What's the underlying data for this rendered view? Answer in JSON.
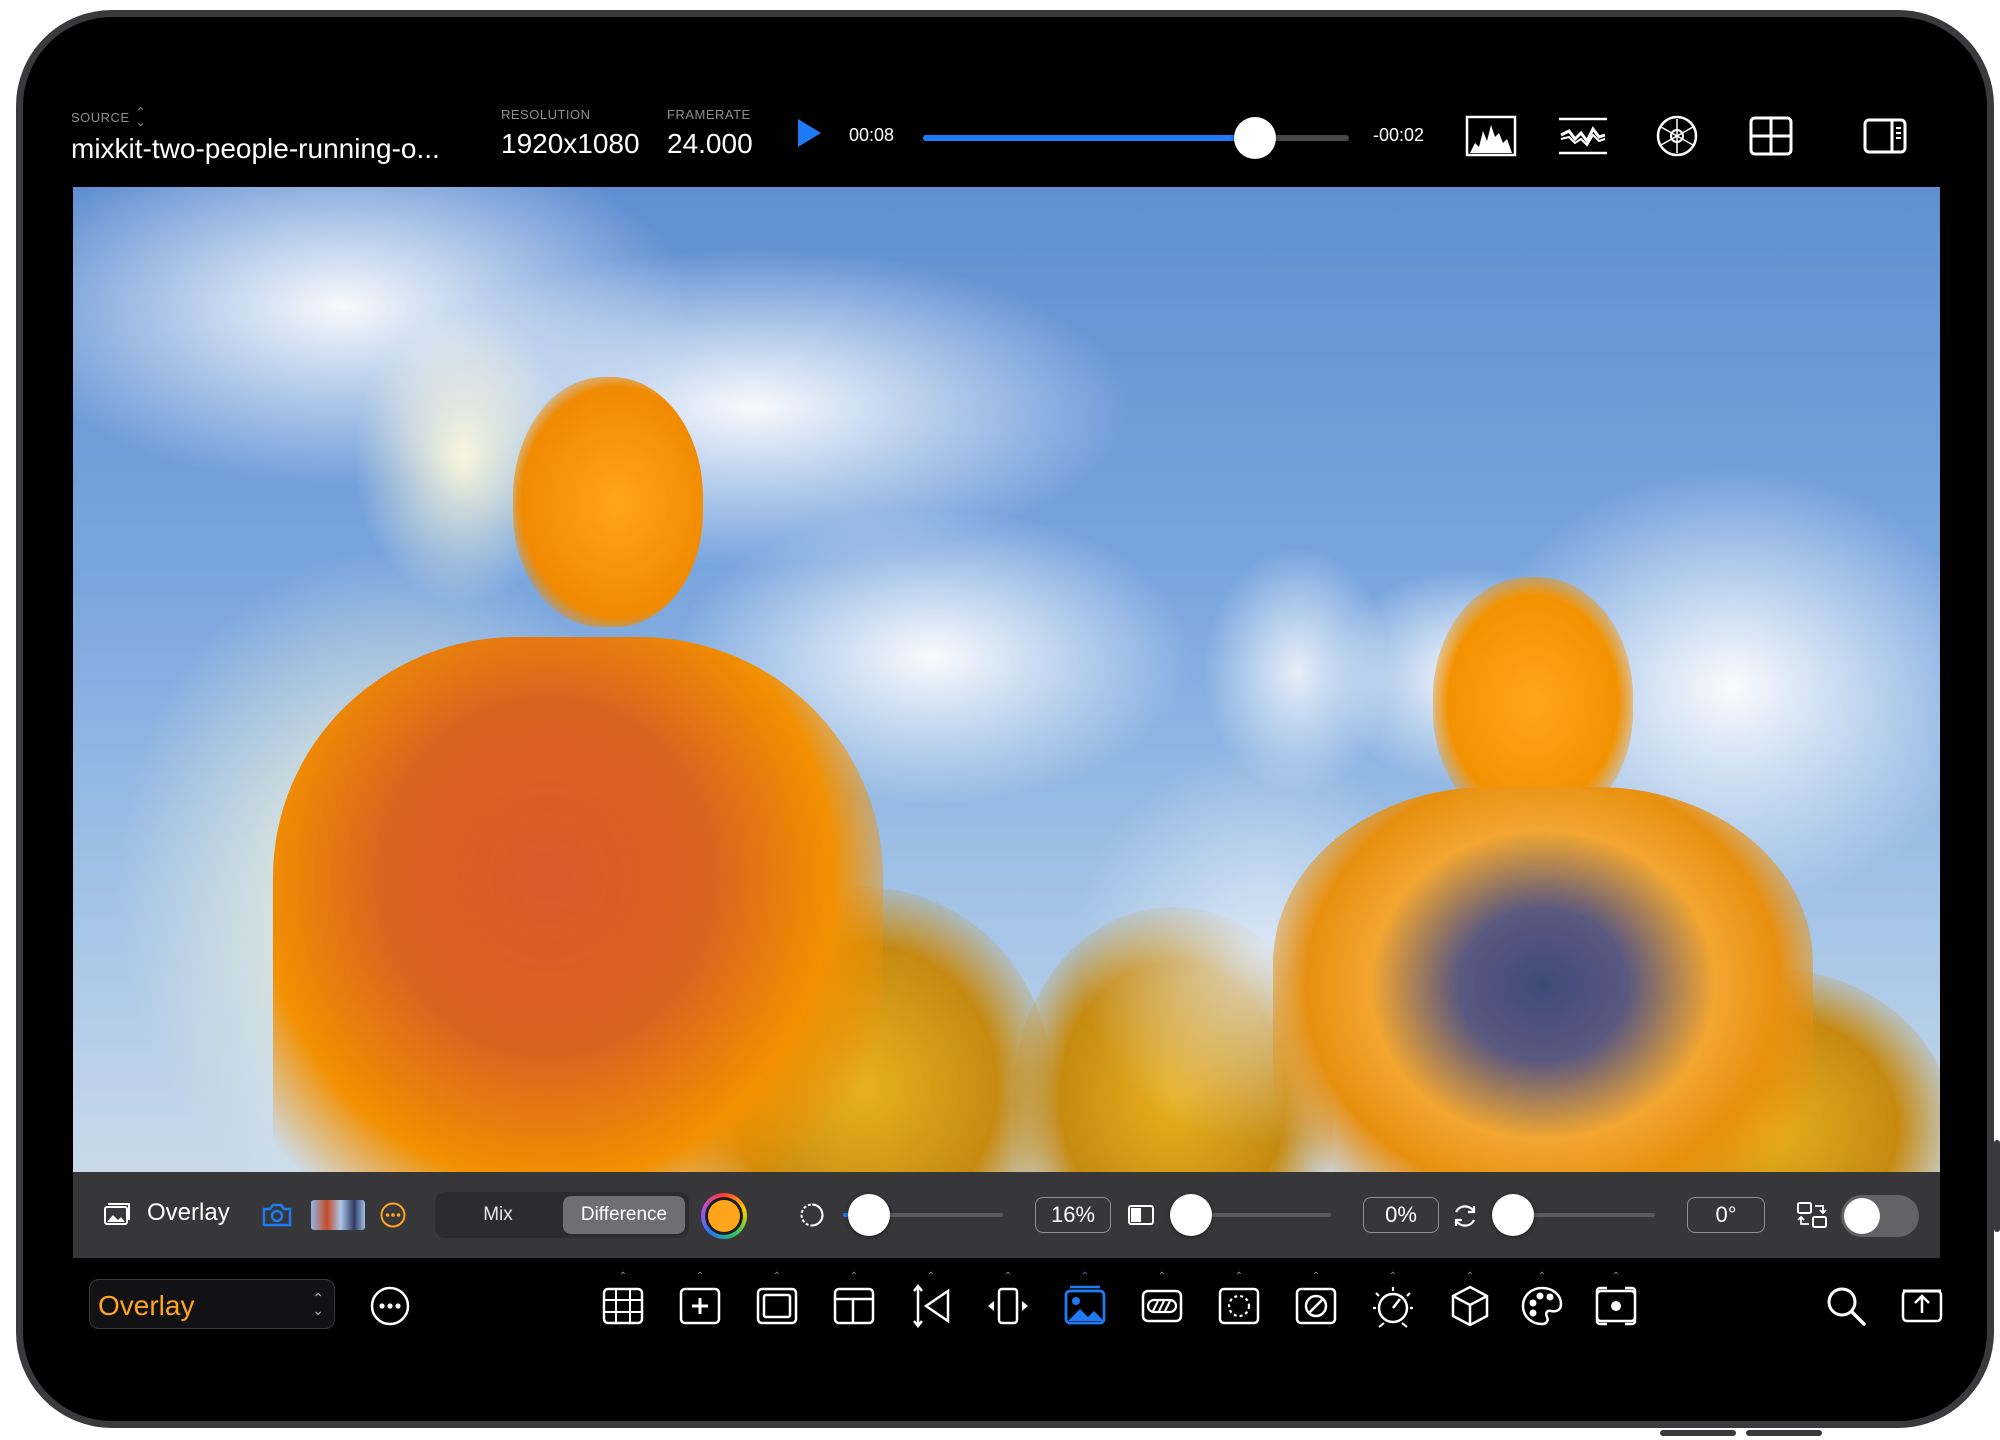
{
  "app": {
    "source_label": "SOURCE",
    "source_value": "mixkit-two-people-running-o...",
    "resolution_label": "RESOLUTION",
    "resolution_value": "1920x1080",
    "framerate_label": "FRAMERATE",
    "framerate_value": "24.000"
  },
  "playback": {
    "elapsed": "00:08",
    "remaining": "-00:02",
    "progress": 0.78
  },
  "top_icons": [
    "histogram-icon",
    "waveform-icon",
    "vectorscope-icon",
    "grid-layout-icon",
    "sidebar-icon"
  ],
  "overlay_bar": {
    "label": "Overlay",
    "blend_modes": [
      "Mix",
      "Difference"
    ],
    "active_blend": "Difference",
    "opacity_value": "16%",
    "opacity_fraction": 0.16,
    "wipe_value": "0%",
    "wipe_fraction": 0.0,
    "rotation_value": "0°",
    "rotation_fraction": 0.0,
    "swap_toggle_on": false,
    "accent_color": "#ffa41b"
  },
  "bottom_bar": {
    "mode_value": "Overlay",
    "tools": [
      "grid-guide-icon",
      "crosshair-icon",
      "safe-area-icon",
      "aspect-frame-icon",
      "perspective-icon",
      "flip-icon",
      "overlay-image-icon",
      "zebra-icon",
      "focus-peaking-icon",
      "false-color-icon",
      "exposure-timer-icon",
      "3d-lut-icon",
      "color-palette-icon",
      "record-frame-icon"
    ],
    "active_tool": "overlay-image-icon"
  },
  "colors": {
    "accent_blue": "#1e7bf5",
    "accent_orange": "#ffa41b"
  }
}
